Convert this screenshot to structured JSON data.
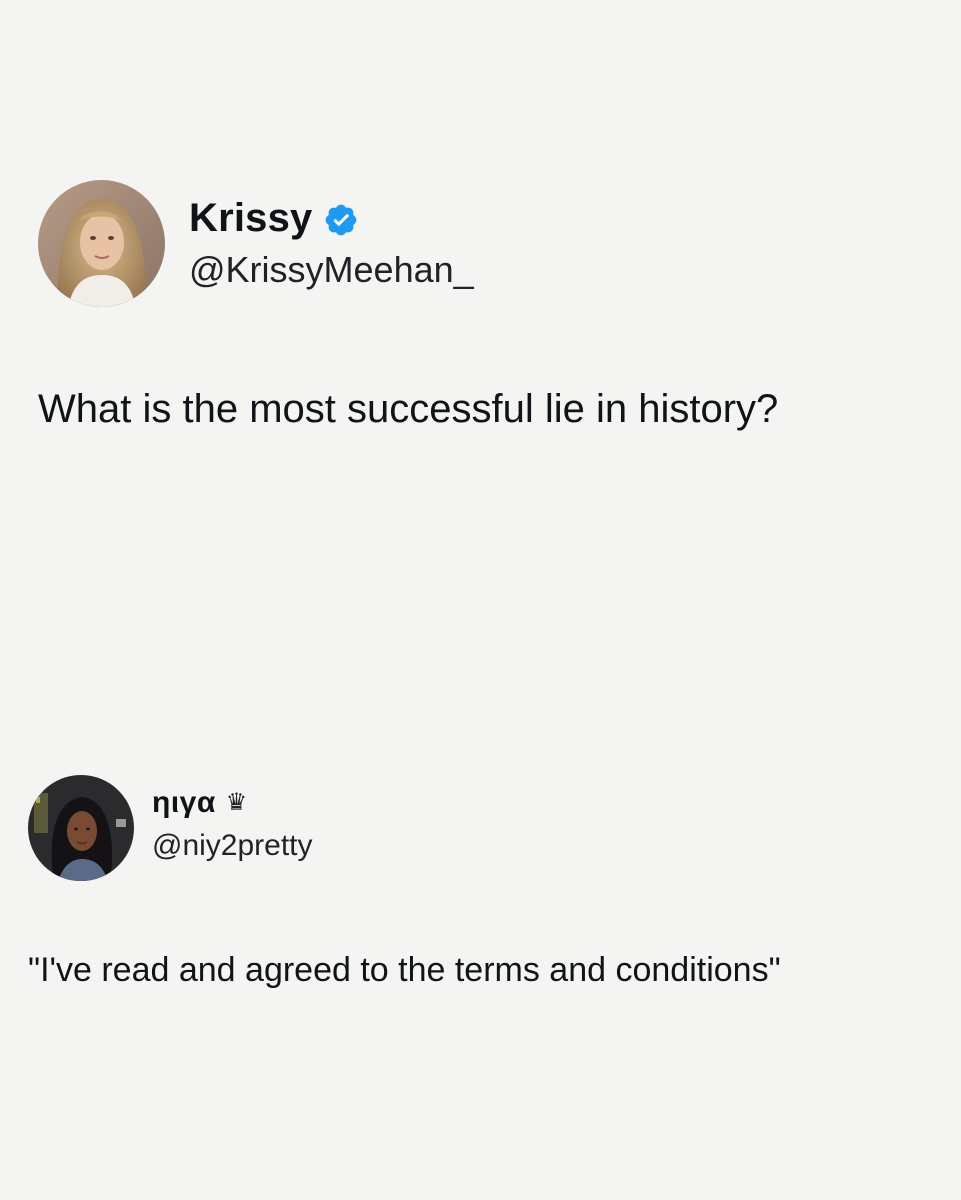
{
  "posts": [
    {
      "display_name": "Krissy",
      "handle": "@KrissyMeehan_",
      "verified": true,
      "text": "What is the most successful lie in history?"
    },
    {
      "display_name": "ηιγα",
      "badge_icon": "crown-icon",
      "badge_glyph": "♛",
      "handle": "@niy2pretty",
      "verified": false,
      "text": "\"I've read and agreed to the terms and conditions\""
    }
  ],
  "colors": {
    "background": "#f4f5f3",
    "text": "#0f1419",
    "verified_blue": "#1d9bf0"
  }
}
